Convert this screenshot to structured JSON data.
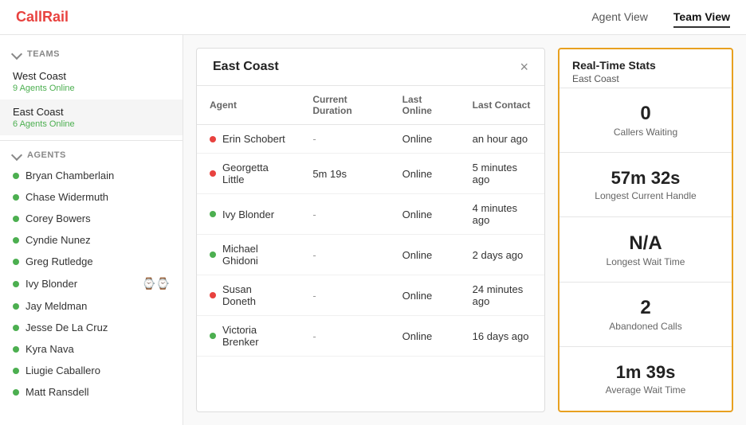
{
  "header": {
    "logo": "CallRail",
    "logo_accent": "Call",
    "nav": [
      {
        "label": "Agent View",
        "active": false
      },
      {
        "label": "Team View",
        "active": true
      }
    ]
  },
  "sidebar": {
    "teams_section_label": "TEAMS",
    "teams": [
      {
        "name": "West Coast",
        "online": "9 Agents Online",
        "active": false
      },
      {
        "name": "East Coast",
        "online": "6 Agents Online",
        "active": true
      }
    ],
    "agents_section_label": "AGENTS",
    "agents": [
      {
        "name": "Bryan Chamberlain",
        "status": "green",
        "icons": false
      },
      {
        "name": "Chase Widermuth",
        "status": "green",
        "icons": false
      },
      {
        "name": "Corey Bowers",
        "status": "green",
        "icons": false
      },
      {
        "name": "Cyndie Nunez",
        "status": "green",
        "icons": false
      },
      {
        "name": "Greg Rutledge",
        "status": "green",
        "icons": false
      },
      {
        "name": "Ivy Blonder",
        "status": "green",
        "icons": true
      },
      {
        "name": "Jay Meldman",
        "status": "green",
        "icons": false
      },
      {
        "name": "Jesse De La Cruz",
        "status": "green",
        "icons": false
      },
      {
        "name": "Kyra Nava",
        "status": "green",
        "icons": false
      },
      {
        "name": "Liugie Caballero",
        "status": "green",
        "icons": false
      },
      {
        "name": "Matt Ransdell",
        "status": "green",
        "icons": false
      }
    ]
  },
  "modal": {
    "title": "East Coast",
    "close_label": "×",
    "table": {
      "headers": [
        "Agent",
        "Current Duration",
        "Last Online",
        "Last Contact"
      ],
      "rows": [
        {
          "name": "Erin Schobert",
          "status": "red",
          "duration": "-",
          "last_online": "Online",
          "last_contact": "an hour ago"
        },
        {
          "name": "Georgetta Little",
          "status": "red",
          "duration": "5m 19s",
          "last_online": "Online",
          "last_contact": "5 minutes ago"
        },
        {
          "name": "Ivy Blonder",
          "status": "green",
          "duration": "-",
          "last_online": "Online",
          "last_contact": "4 minutes ago"
        },
        {
          "name": "Michael Ghidoni",
          "status": "green",
          "duration": "-",
          "last_online": "Online",
          "last_contact": "2 days ago"
        },
        {
          "name": "Susan Doneth",
          "status": "red",
          "duration": "-",
          "last_online": "Online",
          "last_contact": "24 minutes ago"
        },
        {
          "name": "Victoria Brenker",
          "status": "green",
          "duration": "-",
          "last_online": "Online",
          "last_contact": "16 days ago"
        }
      ]
    }
  },
  "stats": {
    "title": "Real-Time Stats",
    "subtitle": "East Coast",
    "items": [
      {
        "value": "0",
        "label": "Callers Waiting"
      },
      {
        "value": "57m 32s",
        "label": "Longest Current Handle"
      },
      {
        "value": "N/A",
        "label": "Longest Wait Time"
      },
      {
        "value": "2",
        "label": "Abandoned Calls"
      },
      {
        "value": "1m 39s",
        "label": "Average Wait Time"
      }
    ]
  }
}
